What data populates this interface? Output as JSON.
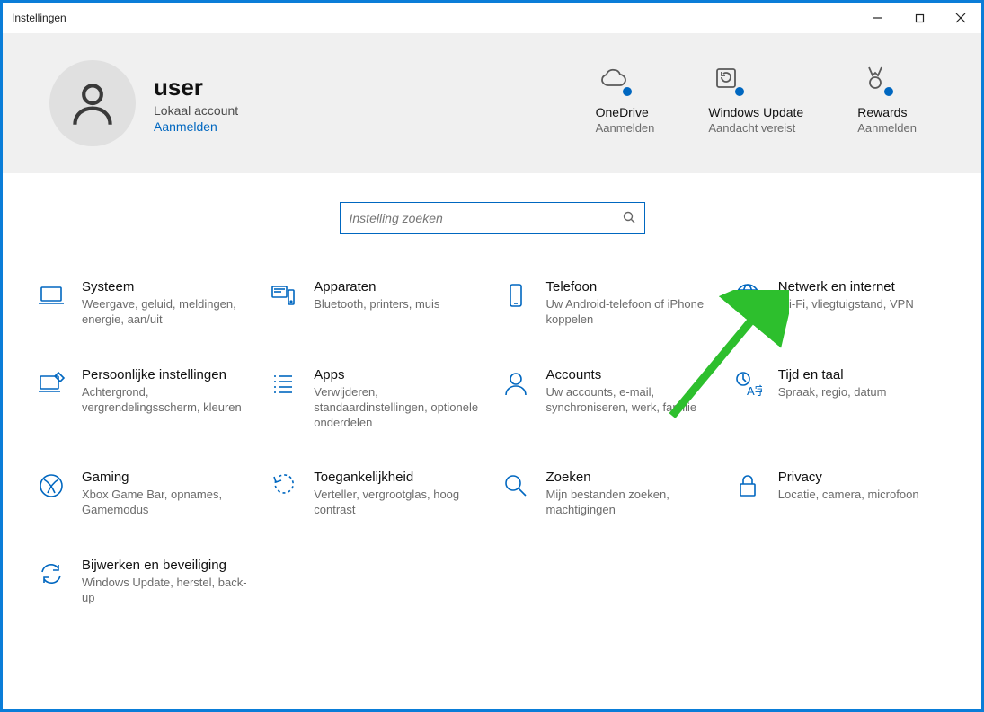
{
  "window": {
    "title": "Instellingen"
  },
  "user": {
    "name": "user",
    "account_type": "Lokaal account",
    "sign_in_label": "Aanmelden"
  },
  "header_cards": {
    "onedrive": {
      "title": "OneDrive",
      "sub": "Aanmelden"
    },
    "update": {
      "title": "Windows Update",
      "sub": "Aandacht vereist"
    },
    "rewards": {
      "title": "Rewards",
      "sub": "Aanmelden"
    }
  },
  "search": {
    "placeholder": "Instelling zoeken"
  },
  "categories": {
    "system": {
      "title": "Systeem",
      "desc": "Weergave, geluid, meldingen, energie, aan/uit"
    },
    "devices": {
      "title": "Apparaten",
      "desc": "Bluetooth, printers, muis"
    },
    "phone": {
      "title": "Telefoon",
      "desc": "Uw Android-telefoon of iPhone koppelen"
    },
    "network": {
      "title": "Netwerk en internet",
      "desc": "Wi-Fi, vliegtuigstand, VPN"
    },
    "personalization": {
      "title": "Persoonlijke instellingen",
      "desc": "Achtergrond, vergrendelingsscherm, kleuren"
    },
    "apps": {
      "title": "Apps",
      "desc": "Verwijderen, standaardinstellingen, optionele onderdelen"
    },
    "accounts": {
      "title": "Accounts",
      "desc": "Uw accounts, e-mail, synchroniseren, werk, familie"
    },
    "time": {
      "title": "Tijd en taal",
      "desc": "Spraak, regio, datum"
    },
    "gaming": {
      "title": "Gaming",
      "desc": "Xbox Game Bar, opnames, Gamemodus"
    },
    "ease": {
      "title": "Toegankelijkheid",
      "desc": "Verteller, vergrootglas, hoog contrast"
    },
    "search_cat": {
      "title": "Zoeken",
      "desc": "Mijn bestanden zoeken, machtigingen"
    },
    "privacy": {
      "title": "Privacy",
      "desc": "Locatie, camera, microfoon"
    },
    "update_cat": {
      "title": "Bijwerken en beveiliging",
      "desc": "Windows Update, herstel, back-up"
    }
  }
}
